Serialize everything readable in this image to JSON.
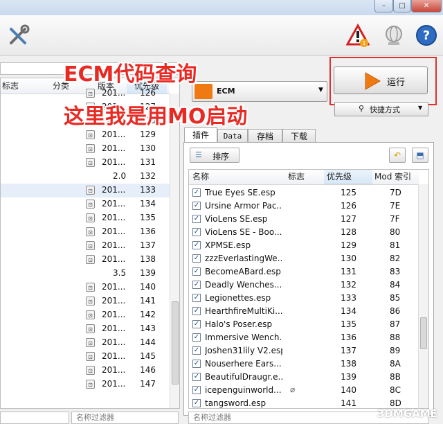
{
  "window": {
    "min_label": "–",
    "max_label": "□",
    "close_label": "✕"
  },
  "left_list": {
    "columns": [
      "标志",
      "分类",
      "版本",
      "优先级"
    ],
    "rows": [
      {
        "version": "201...",
        "priority": "126"
      },
      {
        "version": "201...",
        "priority": "127"
      },
      {
        "version": "201...",
        "priority": "128"
      },
      {
        "version": "201...",
        "priority": "129"
      },
      {
        "version": "201...",
        "priority": "130"
      },
      {
        "version": "201...",
        "priority": "131"
      },
      {
        "version": "2.0",
        "priority": "132"
      },
      {
        "version": "201...",
        "priority": "133"
      },
      {
        "version": "201...",
        "priority": "134"
      },
      {
        "version": "201...",
        "priority": "135"
      },
      {
        "version": "201...",
        "priority": "136"
      },
      {
        "version": "201...",
        "priority": "137"
      },
      {
        "version": "201...",
        "priority": "138"
      },
      {
        "version": "3.5",
        "priority": "139"
      },
      {
        "version": "201...",
        "priority": "140"
      },
      {
        "version": "201...",
        "priority": "141"
      },
      {
        "version": "201...",
        "priority": "142"
      },
      {
        "version": "201...",
        "priority": "143"
      },
      {
        "version": "201...",
        "priority": "144"
      },
      {
        "version": "201...",
        "priority": "145"
      },
      {
        "version": "201...",
        "priority": "146"
      },
      {
        "version": "201...",
        "priority": "147"
      }
    ],
    "filter_placeholder": "名称过滤器"
  },
  "right_panel": {
    "profile_name": "ECM",
    "run_label": "运行",
    "shortcut_label": "快捷方式",
    "tabs": [
      "插件",
      "Data",
      "存档",
      "下载"
    ],
    "sort_label": "排序",
    "columns": [
      "名称",
      "标志",
      "优先级",
      "Mod 索引"
    ],
    "plugins": [
      {
        "name": "True Eyes SE.esp",
        "priority": "125",
        "index": "7D"
      },
      {
        "name": "Ursine Armor Pac...",
        "priority": "126",
        "index": "7E"
      },
      {
        "name": "VioLens SE.esp",
        "priority": "127",
        "index": "7F"
      },
      {
        "name": "VioLens SE - Boo...",
        "priority": "128",
        "index": "80"
      },
      {
        "name": "XPMSE.esp",
        "priority": "129",
        "index": "81"
      },
      {
        "name": "zzzEverlastingWe...",
        "priority": "130",
        "index": "82"
      },
      {
        "name": "BecomeABard.esp",
        "priority": "131",
        "index": "83"
      },
      {
        "name": "Deadly Wenches....",
        "priority": "132",
        "index": "84"
      },
      {
        "name": "Legionettes.esp",
        "priority": "133",
        "index": "85"
      },
      {
        "name": "HearthfireMultiKi...",
        "priority": "134",
        "index": "86"
      },
      {
        "name": "Halo's Poser.esp",
        "priority": "135",
        "index": "87"
      },
      {
        "name": "Immersive Wench...",
        "priority": "136",
        "index": "88"
      },
      {
        "name": "Joshen31lily V2.esp",
        "priority": "137",
        "index": "89"
      },
      {
        "name": "Nouserhere Ears....",
        "priority": "138",
        "index": "8A"
      },
      {
        "name": "BeautifulDraugr.e...",
        "priority": "139",
        "index": "8B"
      },
      {
        "name": "icepenguinworld....",
        "priority": "140",
        "index": "8C"
      },
      {
        "name": "tangsword.esp",
        "priority": "141",
        "index": "8D"
      }
    ],
    "filter_placeholder": "名称过滤器"
  },
  "annotations": {
    "line1": "ECM代码查询",
    "line2": "这里我是用MO启动"
  },
  "watermark": "3DMGAME",
  "colors": {
    "annotation_red": "#e82a24",
    "run_orange": "#f07a12",
    "selection_blue": "#e5eef9"
  }
}
